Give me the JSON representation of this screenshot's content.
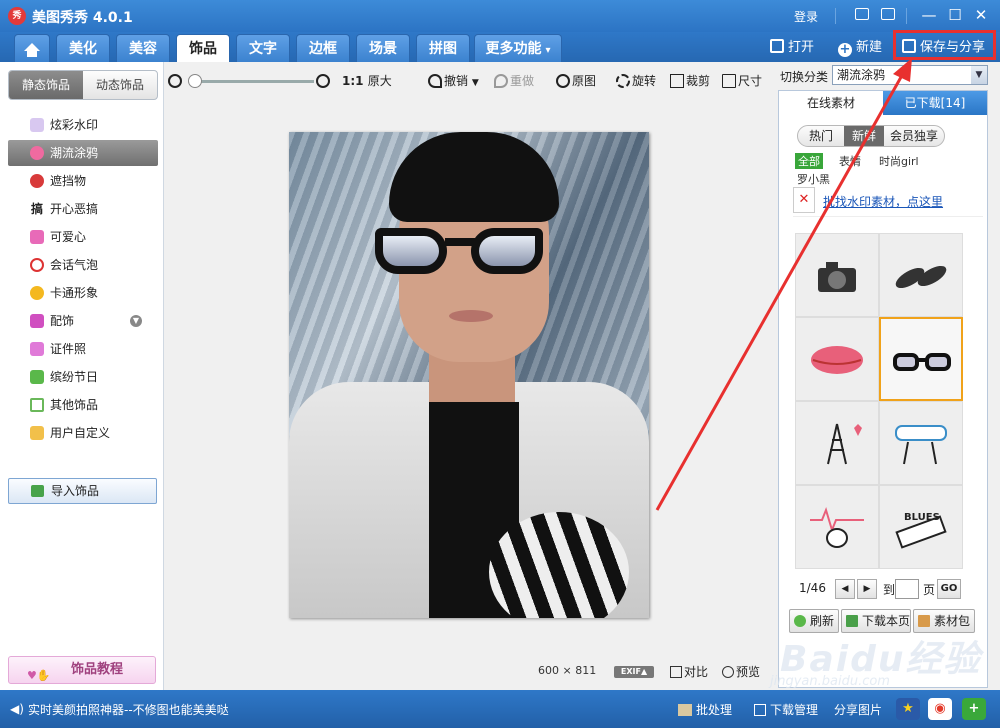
{
  "app": {
    "logo_text": "秀",
    "title": "美图秀秀 4.0.1"
  },
  "titlebar": {
    "login": "登录"
  },
  "tabs": [
    "美化",
    "美容",
    "饰品",
    "文字",
    "边框",
    "场景",
    "拼图",
    "更多功能"
  ],
  "active_tab": "饰品",
  "header_actions": {
    "open": "打开",
    "new": "新建",
    "save_share": "保存与分享"
  },
  "left_panel": {
    "tabs": [
      "静态饰品",
      "动态饰品"
    ],
    "categories": [
      "炫彩水印",
      "潮流涂鸦",
      "遮挡物",
      "开心恶搞",
      "可爱心",
      "会话气泡",
      "卡通形象",
      "配饰",
      "证件照",
      "缤纷节日",
      "其他饰品",
      "用户自定义"
    ],
    "active_category": "潮流涂鸦",
    "import_label": "导入饰品",
    "tutorial_label": "饰品教程"
  },
  "toolbar": {
    "zoom_ratio": "1:1",
    "original_size": "原大",
    "undo": "撤销",
    "redo": "重做",
    "original": "原图",
    "rotate": "旋转",
    "crop": "裁剪",
    "size": "尺寸"
  },
  "image_info": {
    "width": "600",
    "times": "×",
    "height": "811",
    "exif": "EXIF▲"
  },
  "image_actions": {
    "compare": "对比",
    "preview": "预览"
  },
  "right_panel": {
    "category_label": "切换分类",
    "category_value": "潮流涂鸦",
    "tabs": {
      "online": "在线素材",
      "downloaded": "已下载[14]"
    },
    "filters": [
      "热门",
      "新鲜",
      "会员独享"
    ],
    "active_filter": "新鲜",
    "tags": [
      "全部",
      "表情",
      "时尚girl",
      "罗小黑"
    ],
    "tip_link": "批找水印素材，点这里",
    "stickers": [
      "camera-sticker",
      "shoes-sticker",
      "lips-sticker",
      "glasses-sticker",
      "eiffel-tower-sticker",
      "music-god-sticker",
      "heartbeat-sticker",
      "piano-blues-sticker"
    ],
    "selected_sticker": "glasses-sticker",
    "pager": {
      "current": "1/46",
      "goto_label": "到",
      "page_label": "页",
      "go": "GO"
    },
    "buttons": {
      "refresh": "刷新",
      "download_page": "下载本页",
      "material_pack": "素材包"
    }
  },
  "statusbar": {
    "marquee": "实时美颜拍照神器--不修图也能美美哒",
    "batch": "批处理",
    "download_manager": "下载管理",
    "share_image": "分享图片"
  },
  "watermark": {
    "brand": "Baidu经验",
    "url": "jingyan.baidu.com"
  },
  "colors": {
    "title_blue": "#2c74c4",
    "highlight_red": "#e8302f",
    "select_orange": "#f0a21a",
    "tag_green": "#39a63a"
  }
}
